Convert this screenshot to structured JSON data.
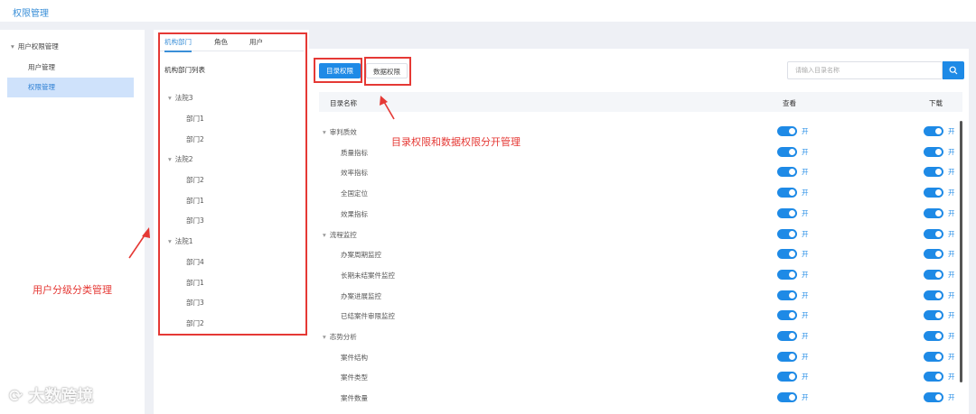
{
  "header": {
    "title": "权限管理"
  },
  "sidebar": {
    "group": "用户权限管理",
    "items": [
      {
        "label": "用户管理",
        "active": false
      },
      {
        "label": "权限管理",
        "active": true
      }
    ]
  },
  "left_panel": {
    "tabs": [
      "机构部门",
      "角色",
      "用户"
    ],
    "active_tab": "机构部门",
    "tree_title": "机构部门列表",
    "tree": [
      {
        "label": "法院3",
        "children": [
          "部门1",
          "部门2"
        ]
      },
      {
        "label": "法院2",
        "children": [
          "部门2",
          "部门1",
          "部门3"
        ]
      },
      {
        "label": "法院1",
        "children": [
          "部门4",
          "部门1",
          "部门3",
          "部门2"
        ]
      }
    ]
  },
  "right_panel": {
    "btn_dir": "目录权限",
    "btn_data": "数据权限",
    "search_placeholder": "请输入目录名称",
    "col_name": "目录名称",
    "col_view": "查看",
    "col_download": "下载",
    "toggle_label": "开",
    "rows": [
      {
        "name": "审判质效",
        "level": 0
      },
      {
        "name": "质量指标",
        "level": 1
      },
      {
        "name": "效率指标",
        "level": 1
      },
      {
        "name": "全国定位",
        "level": 1
      },
      {
        "name": "效果指标",
        "level": 1
      },
      {
        "name": "流程监控",
        "level": 0
      },
      {
        "name": "办案周期监控",
        "level": 1
      },
      {
        "name": "长期未结案件监控",
        "level": 1
      },
      {
        "name": "办案进展监控",
        "level": 1
      },
      {
        "name": "已结案件审限监控",
        "level": 1
      },
      {
        "name": "态势分析",
        "level": 0
      },
      {
        "name": "案件结构",
        "level": 1
      },
      {
        "name": "案件类型",
        "level": 1
      },
      {
        "name": "案件数量",
        "level": 1
      }
    ]
  },
  "annotations": {
    "left": "用户分级分类管理",
    "right": "目录权限和数据权限分开管理"
  },
  "watermark": "大数跨境",
  "colors": {
    "accent": "#1e8ae6",
    "annotation": "#e53935"
  }
}
